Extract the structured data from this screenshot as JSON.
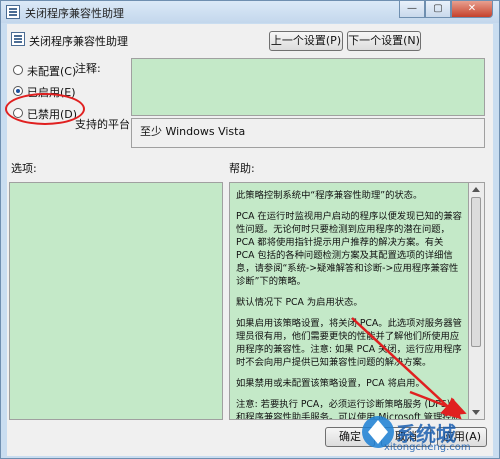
{
  "window": {
    "title": "关闭程序兼容性助理"
  },
  "header": {
    "policy_name": "关闭程序兼容性助理",
    "prev_button": "上一个设置(P)",
    "next_button": "下一个设置(N)"
  },
  "options": [
    {
      "label": "未配置(C)",
      "selected": false
    },
    {
      "label": "已启用(E)",
      "selected": true
    },
    {
      "label": "已禁用(D)",
      "selected": false
    }
  ],
  "comment_label": "注释:",
  "platform": {
    "label": "支持的平台:",
    "value": "至少 Windows Vista"
  },
  "sections": {
    "options_label": "选项:",
    "help_label": "帮助:"
  },
  "help": [
    "此策略控制系统中“程序兼容性助理”的状态。",
    "PCA 在运行时监视用户启动的程序以便发现已知的兼容性问题。无论何时只要检测到应用程序的潜在问题，PCA 都将使用指针提示用户推荐的解决方案。有关 PCA 包括的各种问题检测方案及其配置选项的详细信息，请参阅“系统->疑难解答和诊断->应用程序兼容性诊断”下的策略。",
    "默认情况下 PCA 为启用状态。",
    "如果启用该策略设置，将关闭 PCA。此选项对服务器管理员很有用，他们需要更快的性能并了解他们所使用应用程序的兼容性。注意: 如果 PCA 关闭，运行应用程序时不会向用户提供已知兼容性问题的解决方案。",
    "如果禁用或未配置该策略设置，PCA 将启用。",
    "注意: 若要执行 PCA，必须运行诊断策略服务 (DPS) 和程序兼容性助手服务。可以使用 Microsoft 管理控制台的服务管理单元配置这些服务。"
  ],
  "footer": {
    "ok_button": "确定",
    "cancel_button": "取消",
    "apply_button": "应用(A)"
  },
  "watermark": {
    "brand": "系统城",
    "url": "xitongcheng.com"
  },
  "colors": {
    "green_field": "#c4e9c8",
    "highlight_circle": "#e02020",
    "arrow": "#e02020"
  }
}
